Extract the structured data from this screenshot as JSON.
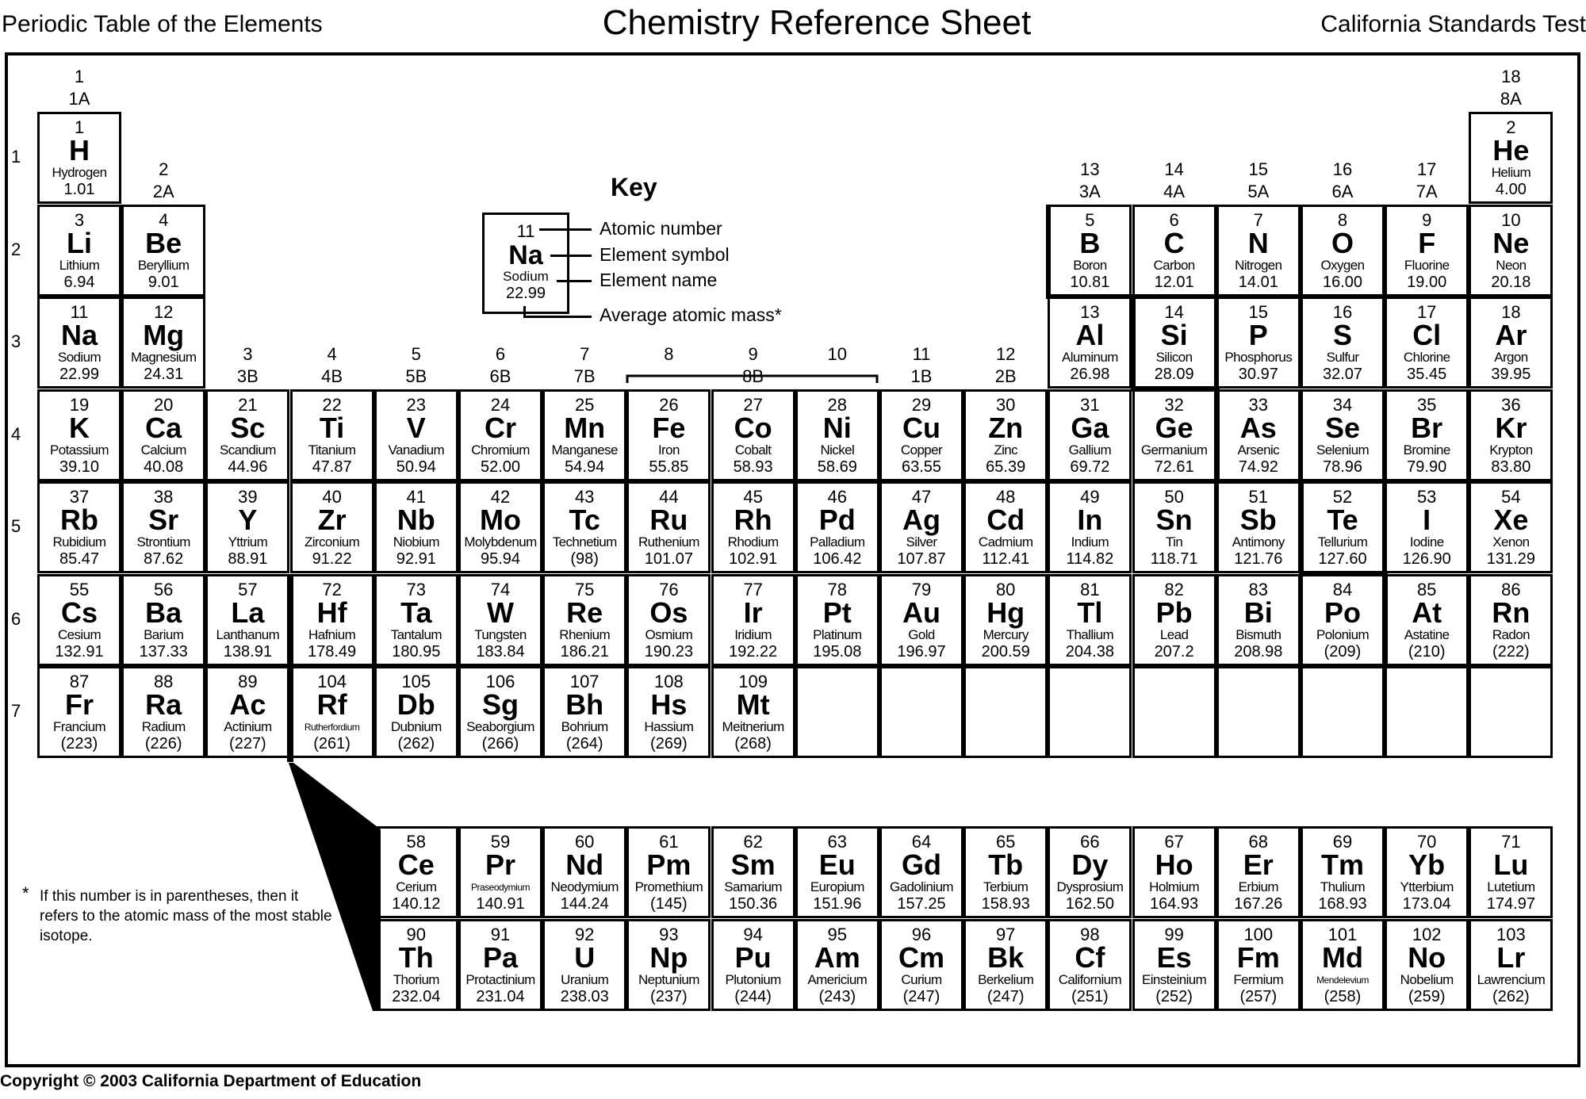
{
  "header": {
    "left": "Periodic Table of the Elements",
    "center": "Chemistry Reference Sheet",
    "right": "California Standards Test"
  },
  "key": {
    "title": "Key",
    "sample": {
      "number": "11",
      "symbol": "Na",
      "name": "Sodium",
      "mass": "22.99"
    },
    "labels": [
      "Atomic number",
      "Element symbol",
      "Element name",
      "Average atomic mass*"
    ]
  },
  "footnote": {
    "star": "*",
    "text": "If this number is in parentheses, then it refers to the atomic mass of the most stable isotope."
  },
  "copyright": "Copyright © 2003 California Department of Education",
  "periods": [
    "1",
    "2",
    "3",
    "4",
    "5",
    "6",
    "7"
  ],
  "groups": [
    {
      "col": 1,
      "num": "1",
      "label": "1A"
    },
    {
      "col": 2,
      "num": "2",
      "label": "2A"
    },
    {
      "col": 3,
      "num": "3",
      "label": "3B"
    },
    {
      "col": 4,
      "num": "4",
      "label": "4B"
    },
    {
      "col": 5,
      "num": "5",
      "label": "5B"
    },
    {
      "col": 6,
      "num": "6",
      "label": "6B"
    },
    {
      "col": 7,
      "num": "7",
      "label": "7B"
    },
    {
      "col": 8,
      "num": "8",
      "label": ""
    },
    {
      "col": 9,
      "num": "9",
      "label": "8B"
    },
    {
      "col": 10,
      "num": "10",
      "label": ""
    },
    {
      "col": 11,
      "num": "11",
      "label": "1B"
    },
    {
      "col": 12,
      "num": "12",
      "label": "2B"
    },
    {
      "col": 13,
      "num": "13",
      "label": "3A"
    },
    {
      "col": 14,
      "num": "14",
      "label": "4A"
    },
    {
      "col": 15,
      "num": "15",
      "label": "5A"
    },
    {
      "col": 16,
      "num": "16",
      "label": "6A"
    },
    {
      "col": 17,
      "num": "17",
      "label": "7A"
    },
    {
      "col": 18,
      "num": "18",
      "label": "8A"
    }
  ],
  "elements": [
    {
      "n": "1",
      "s": "H",
      "name": "Hydrogen",
      "m": "1.01",
      "row": 1,
      "col": 1
    },
    {
      "n": "2",
      "s": "He",
      "name": "Helium",
      "m": "4.00",
      "row": 1,
      "col": 18
    },
    {
      "n": "3",
      "s": "Li",
      "name": "Lithium",
      "m": "6.94",
      "row": 2,
      "col": 1
    },
    {
      "n": "4",
      "s": "Be",
      "name": "Beryllium",
      "m": "9.01",
      "row": 2,
      "col": 2
    },
    {
      "n": "5",
      "s": "B",
      "name": "Boron",
      "m": "10.81",
      "row": 2,
      "col": 13
    },
    {
      "n": "6",
      "s": "C",
      "name": "Carbon",
      "m": "12.01",
      "row": 2,
      "col": 14
    },
    {
      "n": "7",
      "s": "N",
      "name": "Nitrogen",
      "m": "14.01",
      "row": 2,
      "col": 15
    },
    {
      "n": "8",
      "s": "O",
      "name": "Oxygen",
      "m": "16.00",
      "row": 2,
      "col": 16
    },
    {
      "n": "9",
      "s": "F",
      "name": "Fluorine",
      "m": "19.00",
      "row": 2,
      "col": 17
    },
    {
      "n": "10",
      "s": "Ne",
      "name": "Neon",
      "m": "20.18",
      "row": 2,
      "col": 18
    },
    {
      "n": "11",
      "s": "Na",
      "name": "Sodium",
      "m": "22.99",
      "row": 3,
      "col": 1
    },
    {
      "n": "12",
      "s": "Mg",
      "name": "Magnesium",
      "m": "24.31",
      "row": 3,
      "col": 2
    },
    {
      "n": "13",
      "s": "Al",
      "name": "Aluminum",
      "m": "26.98",
      "row": 3,
      "col": 13
    },
    {
      "n": "14",
      "s": "Si",
      "name": "Silicon",
      "m": "28.09",
      "row": 3,
      "col": 14
    },
    {
      "n": "15",
      "s": "P",
      "name": "Phosphorus",
      "m": "30.97",
      "row": 3,
      "col": 15
    },
    {
      "n": "16",
      "s": "S",
      "name": "Sulfur",
      "m": "32.07",
      "row": 3,
      "col": 16
    },
    {
      "n": "17",
      "s": "Cl",
      "name": "Chlorine",
      "m": "35.45",
      "row": 3,
      "col": 17
    },
    {
      "n": "18",
      "s": "Ar",
      "name": "Argon",
      "m": "39.95",
      "row": 3,
      "col": 18
    },
    {
      "n": "19",
      "s": "K",
      "name": "Potassium",
      "m": "39.10",
      "row": 4,
      "col": 1
    },
    {
      "n": "20",
      "s": "Ca",
      "name": "Calcium",
      "m": "40.08",
      "row": 4,
      "col": 2
    },
    {
      "n": "21",
      "s": "Sc",
      "name": "Scandium",
      "m": "44.96",
      "row": 4,
      "col": 3
    },
    {
      "n": "22",
      "s": "Ti",
      "name": "Titanium",
      "m": "47.87",
      "row": 4,
      "col": 4
    },
    {
      "n": "23",
      "s": "V",
      "name": "Vanadium",
      "m": "50.94",
      "row": 4,
      "col": 5
    },
    {
      "n": "24",
      "s": "Cr",
      "name": "Chromium",
      "m": "52.00",
      "row": 4,
      "col": 6
    },
    {
      "n": "25",
      "s": "Mn",
      "name": "Manganese",
      "m": "54.94",
      "row": 4,
      "col": 7
    },
    {
      "n": "26",
      "s": "Fe",
      "name": "Iron",
      "m": "55.85",
      "row": 4,
      "col": 8
    },
    {
      "n": "27",
      "s": "Co",
      "name": "Cobalt",
      "m": "58.93",
      "row": 4,
      "col": 9
    },
    {
      "n": "28",
      "s": "Ni",
      "name": "Nickel",
      "m": "58.69",
      "row": 4,
      "col": 10
    },
    {
      "n": "29",
      "s": "Cu",
      "name": "Copper",
      "m": "63.55",
      "row": 4,
      "col": 11
    },
    {
      "n": "30",
      "s": "Zn",
      "name": "Zinc",
      "m": "65.39",
      "row": 4,
      "col": 12
    },
    {
      "n": "31",
      "s": "Ga",
      "name": "Gallium",
      "m": "69.72",
      "row": 4,
      "col": 13
    },
    {
      "n": "32",
      "s": "Ge",
      "name": "Germanium",
      "m": "72.61",
      "row": 4,
      "col": 14
    },
    {
      "n": "33",
      "s": "As",
      "name": "Arsenic",
      "m": "74.92",
      "row": 4,
      "col": 15
    },
    {
      "n": "34",
      "s": "Se",
      "name": "Selenium",
      "m": "78.96",
      "row": 4,
      "col": 16
    },
    {
      "n": "35",
      "s": "Br",
      "name": "Bromine",
      "m": "79.90",
      "row": 4,
      "col": 17
    },
    {
      "n": "36",
      "s": "Kr",
      "name": "Krypton",
      "m": "83.80",
      "row": 4,
      "col": 18
    },
    {
      "n": "37",
      "s": "Rb",
      "name": "Rubidium",
      "m": "85.47",
      "row": 5,
      "col": 1
    },
    {
      "n": "38",
      "s": "Sr",
      "name": "Strontium",
      "m": "87.62",
      "row": 5,
      "col": 2
    },
    {
      "n": "39",
      "s": "Y",
      "name": "Yttrium",
      "m": "88.91",
      "row": 5,
      "col": 3
    },
    {
      "n": "40",
      "s": "Zr",
      "name": "Zirconium",
      "m": "91.22",
      "row": 5,
      "col": 4
    },
    {
      "n": "41",
      "s": "Nb",
      "name": "Niobium",
      "m": "92.91",
      "row": 5,
      "col": 5
    },
    {
      "n": "42",
      "s": "Mo",
      "name": "Molybdenum",
      "m": "95.94",
      "row": 5,
      "col": 6
    },
    {
      "n": "43",
      "s": "Tc",
      "name": "Technetium",
      "m": "(98)",
      "row": 5,
      "col": 7
    },
    {
      "n": "44",
      "s": "Ru",
      "name": "Ruthenium",
      "m": "101.07",
      "row": 5,
      "col": 8
    },
    {
      "n": "45",
      "s": "Rh",
      "name": "Rhodium",
      "m": "102.91",
      "row": 5,
      "col": 9
    },
    {
      "n": "46",
      "s": "Pd",
      "name": "Palladium",
      "m": "106.42",
      "row": 5,
      "col": 10
    },
    {
      "n": "47",
      "s": "Ag",
      "name": "Silver",
      "m": "107.87",
      "row": 5,
      "col": 11
    },
    {
      "n": "48",
      "s": "Cd",
      "name": "Cadmium",
      "m": "112.41",
      "row": 5,
      "col": 12
    },
    {
      "n": "49",
      "s": "In",
      "name": "Indium",
      "m": "114.82",
      "row": 5,
      "col": 13
    },
    {
      "n": "50",
      "s": "Sn",
      "name": "Tin",
      "m": "118.71",
      "row": 5,
      "col": 14
    },
    {
      "n": "51",
      "s": "Sb",
      "name": "Antimony",
      "m": "121.76",
      "row": 5,
      "col": 15
    },
    {
      "n": "52",
      "s": "Te",
      "name": "Tellurium",
      "m": "127.60",
      "row": 5,
      "col": 16
    },
    {
      "n": "53",
      "s": "I",
      "name": "Iodine",
      "m": "126.90",
      "row": 5,
      "col": 17
    },
    {
      "n": "54",
      "s": "Xe",
      "name": "Xenon",
      "m": "131.29",
      "row": 5,
      "col": 18
    },
    {
      "n": "55",
      "s": "Cs",
      "name": "Cesium",
      "m": "132.91",
      "row": 6,
      "col": 1
    },
    {
      "n": "56",
      "s": "Ba",
      "name": "Barium",
      "m": "137.33",
      "row": 6,
      "col": 2
    },
    {
      "n": "57",
      "s": "La",
      "name": "Lanthanum",
      "m": "138.91",
      "row": 6,
      "col": 3
    },
    {
      "n": "72",
      "s": "Hf",
      "name": "Hafnium",
      "m": "178.49",
      "row": 6,
      "col": 4
    },
    {
      "n": "73",
      "s": "Ta",
      "name": "Tantalum",
      "m": "180.95",
      "row": 6,
      "col": 5
    },
    {
      "n": "74",
      "s": "W",
      "name": "Tungsten",
      "m": "183.84",
      "row": 6,
      "col": 6
    },
    {
      "n": "75",
      "s": "Re",
      "name": "Rhenium",
      "m": "186.21",
      "row": 6,
      "col": 7
    },
    {
      "n": "76",
      "s": "Os",
      "name": "Osmium",
      "m": "190.23",
      "row": 6,
      "col": 8
    },
    {
      "n": "77",
      "s": "Ir",
      "name": "Iridium",
      "m": "192.22",
      "row": 6,
      "col": 9
    },
    {
      "n": "78",
      "s": "Pt",
      "name": "Platinum",
      "m": "195.08",
      "row": 6,
      "col": 10
    },
    {
      "n": "79",
      "s": "Au",
      "name": "Gold",
      "m": "196.97",
      "row": 6,
      "col": 11
    },
    {
      "n": "80",
      "s": "Hg",
      "name": "Mercury",
      "m": "200.59",
      "row": 6,
      "col": 12
    },
    {
      "n": "81",
      "s": "Tl",
      "name": "Thallium",
      "m": "204.38",
      "row": 6,
      "col": 13
    },
    {
      "n": "82",
      "s": "Pb",
      "name": "Lead",
      "m": "207.2",
      "row": 6,
      "col": 14
    },
    {
      "n": "83",
      "s": "Bi",
      "name": "Bismuth",
      "m": "208.98",
      "row": 6,
      "col": 15
    },
    {
      "n": "84",
      "s": "Po",
      "name": "Polonium",
      "m": "(209)",
      "row": 6,
      "col": 16
    },
    {
      "n": "85",
      "s": "At",
      "name": "Astatine",
      "m": "(210)",
      "row": 6,
      "col": 17
    },
    {
      "n": "86",
      "s": "Rn",
      "name": "Radon",
      "m": "(222)",
      "row": 6,
      "col": 18
    },
    {
      "n": "87",
      "s": "Fr",
      "name": "Francium",
      "m": "(223)",
      "row": 7,
      "col": 1
    },
    {
      "n": "88",
      "s": "Ra",
      "name": "Radium",
      "m": "(226)",
      "row": 7,
      "col": 2
    },
    {
      "n": "89",
      "s": "Ac",
      "name": "Actinium",
      "m": "(227)",
      "row": 7,
      "col": 3
    },
    {
      "n": "104",
      "s": "Rf",
      "name": "Rutherfordium",
      "m": "(261)",
      "row": 7,
      "col": 4,
      "small": true
    },
    {
      "n": "105",
      "s": "Db",
      "name": "Dubnium",
      "m": "(262)",
      "row": 7,
      "col": 5
    },
    {
      "n": "106",
      "s": "Sg",
      "name": "Seaborgium",
      "m": "(266)",
      "row": 7,
      "col": 6
    },
    {
      "n": "107",
      "s": "Bh",
      "name": "Bohrium",
      "m": "(264)",
      "row": 7,
      "col": 7
    },
    {
      "n": "108",
      "s": "Hs",
      "name": "Hassium",
      "m": "(269)",
      "row": 7,
      "col": 8
    },
    {
      "n": "109",
      "s": "Mt",
      "name": "Meitnerium",
      "m": "(268)",
      "row": 7,
      "col": 9
    },
    {
      "n": "58",
      "s": "Ce",
      "name": "Cerium",
      "m": "140.12",
      "row": 8,
      "col": 5
    },
    {
      "n": "59",
      "s": "Pr",
      "name": "Praseodymium",
      "m": "140.91",
      "row": 8,
      "col": 6,
      "small": true
    },
    {
      "n": "60",
      "s": "Nd",
      "name": "Neodymium",
      "m": "144.24",
      "row": 8,
      "col": 7
    },
    {
      "n": "61",
      "s": "Pm",
      "name": "Promethium",
      "m": "(145)",
      "row": 8,
      "col": 8
    },
    {
      "n": "62",
      "s": "Sm",
      "name": "Samarium",
      "m": "150.36",
      "row": 8,
      "col": 9
    },
    {
      "n": "63",
      "s": "Eu",
      "name": "Europium",
      "m": "151.96",
      "row": 8,
      "col": 10
    },
    {
      "n": "64",
      "s": "Gd",
      "name": "Gadolinium",
      "m": "157.25",
      "row": 8,
      "col": 11
    },
    {
      "n": "65",
      "s": "Tb",
      "name": "Terbium",
      "m": "158.93",
      "row": 8,
      "col": 12
    },
    {
      "n": "66",
      "s": "Dy",
      "name": "Dysprosium",
      "m": "162.50",
      "row": 8,
      "col": 13
    },
    {
      "n": "67",
      "s": "Ho",
      "name": "Holmium",
      "m": "164.93",
      "row": 8,
      "col": 14
    },
    {
      "n": "68",
      "s": "Er",
      "name": "Erbium",
      "m": "167.26",
      "row": 8,
      "col": 15
    },
    {
      "n": "69",
      "s": "Tm",
      "name": "Thulium",
      "m": "168.93",
      "row": 8,
      "col": 16
    },
    {
      "n": "70",
      "s": "Yb",
      "name": "Ytterbium",
      "m": "173.04",
      "row": 8,
      "col": 17
    },
    {
      "n": "71",
      "s": "Lu",
      "name": "Lutetium",
      "m": "174.97",
      "row": 8,
      "col": 18
    },
    {
      "n": "90",
      "s": "Th",
      "name": "Thorium",
      "m": "232.04",
      "row": 9,
      "col": 5
    },
    {
      "n": "91",
      "s": "Pa",
      "name": "Protactinium",
      "m": "231.04",
      "row": 9,
      "col": 6
    },
    {
      "n": "92",
      "s": "U",
      "name": "Uranium",
      "m": "238.03",
      "row": 9,
      "col": 7
    },
    {
      "n": "93",
      "s": "Np",
      "name": "Neptunium",
      "m": "(237)",
      "row": 9,
      "col": 8
    },
    {
      "n": "94",
      "s": "Pu",
      "name": "Plutonium",
      "m": "(244)",
      "row": 9,
      "col": 9
    },
    {
      "n": "95",
      "s": "Am",
      "name": "Americium",
      "m": "(243)",
      "row": 9,
      "col": 10
    },
    {
      "n": "96",
      "s": "Cm",
      "name": "Curium",
      "m": "(247)",
      "row": 9,
      "col": 11
    },
    {
      "n": "97",
      "s": "Bk",
      "name": "Berkelium",
      "m": "(247)",
      "row": 9,
      "col": 12
    },
    {
      "n": "98",
      "s": "Cf",
      "name": "Californium",
      "m": "(251)",
      "row": 9,
      "col": 13
    },
    {
      "n": "99",
      "s": "Es",
      "name": "Einsteinium",
      "m": "(252)",
      "row": 9,
      "col": 14
    },
    {
      "n": "100",
      "s": "Fm",
      "name": "Fermium",
      "m": "(257)",
      "row": 9,
      "col": 15
    },
    {
      "n": "101",
      "s": "Md",
      "name": "Mendelevium",
      "m": "(258)",
      "row": 9,
      "col": 16,
      "small": true
    },
    {
      "n": "102",
      "s": "No",
      "name": "Nobelium",
      "m": "(259)",
      "row": 9,
      "col": 17
    },
    {
      "n": "103",
      "s": "Lr",
      "name": "Lawrencium",
      "m": "(262)",
      "row": 9,
      "col": 18
    }
  ],
  "empty_cells": [
    {
      "row": 7,
      "col": 10
    },
    {
      "row": 7,
      "col": 11
    },
    {
      "row": 7,
      "col": 12
    },
    {
      "row": 7,
      "col": 13
    },
    {
      "row": 7,
      "col": 14
    },
    {
      "row": 7,
      "col": 15
    },
    {
      "row": 7,
      "col": 16
    },
    {
      "row": 7,
      "col": 17
    },
    {
      "row": 7,
      "col": 18
    }
  ]
}
